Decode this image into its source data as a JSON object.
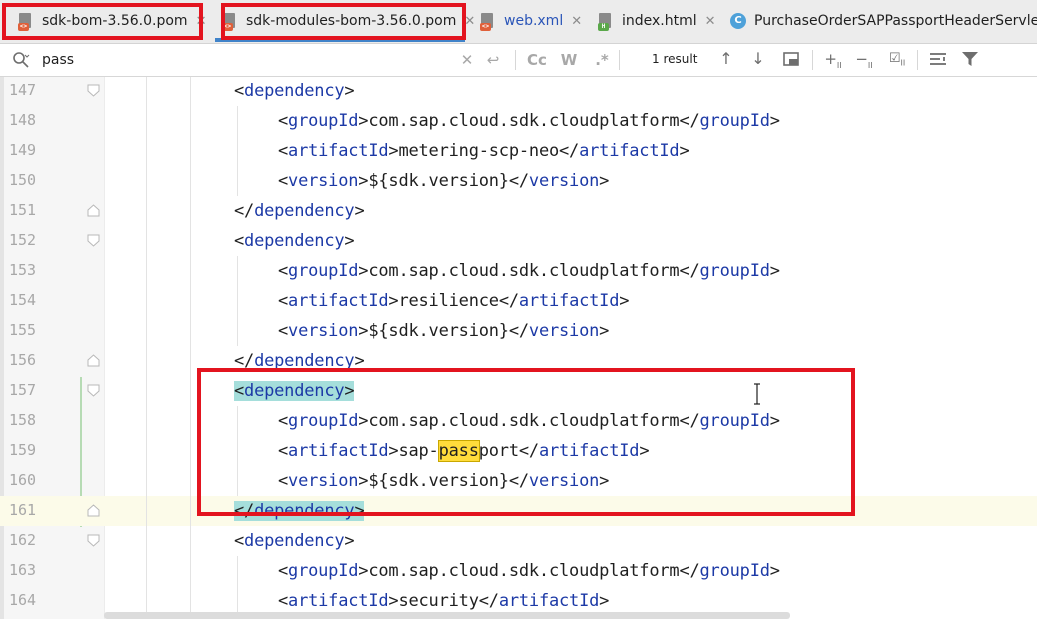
{
  "tabs": [
    {
      "label": "sdk-bom-3.56.0.pom",
      "icon": "pom-file-icon",
      "badge": "<>"
    },
    {
      "label": "sdk-modules-bom-3.56.0.pom",
      "icon": "pom-file-icon",
      "badge": "<>",
      "active": true
    },
    {
      "label": "web.xml",
      "icon": "web-xml-file-icon",
      "badge": "<>"
    },
    {
      "label": "index.html",
      "icon": "html-file-icon",
      "badge": "H"
    },
    {
      "label": "PurchaseOrderSAPPassportHeaderServlet.ja",
      "icon": "java-class-icon",
      "badge": "C"
    }
  ],
  "search": {
    "value": "pass",
    "case_label": "Cc",
    "word_label": "W",
    "regex_label": ".*",
    "results": "1 result"
  },
  "editor": {
    "lines": [
      {
        "n": "147",
        "indent": 1,
        "tag": "dependency",
        "close": false
      },
      {
        "n": "148",
        "indent": 2,
        "tag": "groupId",
        "text": "com.sap.cloud.sdk.cloudplatform"
      },
      {
        "n": "149",
        "indent": 2,
        "tag": "artifactId",
        "text": "metering-scp-neo"
      },
      {
        "n": "150",
        "indent": 2,
        "tag": "version",
        "text": "${sdk.version}"
      },
      {
        "n": "151",
        "indent": 1,
        "tag": "dependency",
        "close": true
      },
      {
        "n": "152",
        "indent": 1,
        "tag": "dependency",
        "close": false
      },
      {
        "n": "153",
        "indent": 2,
        "tag": "groupId",
        "text": "com.sap.cloud.sdk.cloudplatform"
      },
      {
        "n": "154",
        "indent": 2,
        "tag": "artifactId",
        "text": "resilience"
      },
      {
        "n": "155",
        "indent": 2,
        "tag": "version",
        "text": "${sdk.version}"
      },
      {
        "n": "156",
        "indent": 1,
        "tag": "dependency",
        "close": true
      },
      {
        "n": "157",
        "indent": 1,
        "tag": "dependency",
        "close": false
      },
      {
        "n": "158",
        "indent": 2,
        "tag": "groupId",
        "text": "com.sap.cloud.sdk.cloudplatform"
      },
      {
        "n": "159",
        "indent": 2,
        "tag": "artifactId",
        "text": "sap-passport"
      },
      {
        "n": "160",
        "indent": 2,
        "tag": "version",
        "text": "${sdk.version}"
      },
      {
        "n": "161",
        "indent": 1,
        "tag": "dependency",
        "close": true
      },
      {
        "n": "162",
        "indent": 1,
        "tag": "dependency",
        "close": false
      },
      {
        "n": "163",
        "indent": 2,
        "tag": "groupId",
        "text": "com.sap.cloud.sdk.cloudplatform"
      },
      {
        "n": "164",
        "indent": 2,
        "tag": "artifactId",
        "text": "security"
      }
    ],
    "current_line": "161",
    "matched_tag_lines": [
      "157",
      "161"
    ],
    "search_hit_line": "159",
    "search_hit_text": "pass"
  },
  "colors": {
    "tag": "#1c39a6",
    "highlight_box": "#e3141f",
    "search_hit": "#ffdc3b",
    "tag_match": "#a5dedb"
  }
}
